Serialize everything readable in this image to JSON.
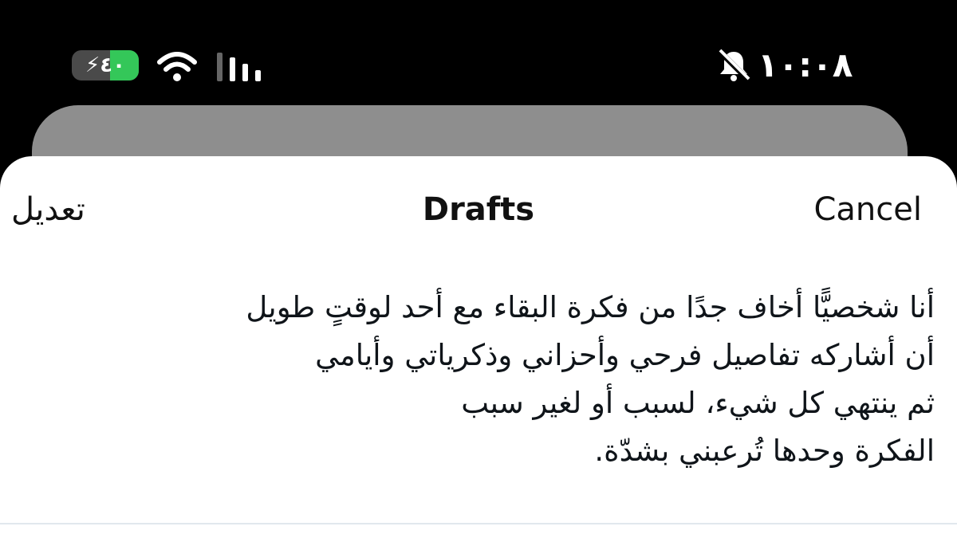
{
  "status_bar": {
    "battery_level": "٤٠",
    "time": "١٠:٠٨",
    "icons": [
      "battery-charging-icon",
      "wifi-icon",
      "cellular-signal-icon",
      "silent-bell-icon"
    ]
  },
  "sheet": {
    "title": "Drafts",
    "edit_label": "تعديل",
    "cancel_label": "Cancel"
  },
  "drafts": [
    {
      "text": "أنا شخصيًّا أخاف جدًا من فكرة البقاء مع أحد لوقتٍ طويل\nأن أشاركه تفاصيل فرحي وأحزاني وذكرياتي وأيامي\nثم ينتهي كل شيء، لسبب أو لغير سبب\nالفكرة وحدها تُرعبني بشدّة."
    }
  ],
  "colors": {
    "background": "#000000",
    "sheet": "#ffffff",
    "card_behind": "#8e8e8e",
    "battery_fill": "#34c759",
    "text": "#0f1419",
    "divider": "#e1e8ed"
  }
}
